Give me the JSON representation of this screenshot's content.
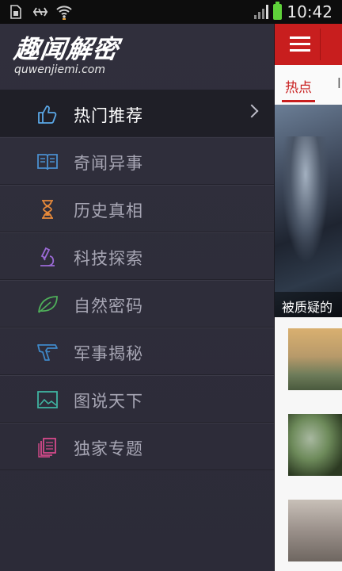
{
  "status_bar": {
    "time": "10:42",
    "icons": [
      "sim-icon",
      "usb-icon",
      "wifi-icon",
      "signal-icon",
      "battery-icon"
    ]
  },
  "drawer": {
    "brand_title": "趣闻解密",
    "brand_subtitle": "quwenjiemi.com",
    "items": [
      {
        "label": "热门推荐",
        "icon": "thumbs-up-icon",
        "color": "#5aa7e6",
        "active": true
      },
      {
        "label": "奇闻异事",
        "icon": "open-book-icon",
        "color": "#4a8fd0",
        "active": false
      },
      {
        "label": "历史真相",
        "icon": "hourglass-icon",
        "color": "#e88a3a",
        "active": false
      },
      {
        "label": "科技探索",
        "icon": "microscope-icon",
        "color": "#9b6ad6",
        "active": false
      },
      {
        "label": "自然密码",
        "icon": "leaf-icon",
        "color": "#4fb05a",
        "active": false
      },
      {
        "label": "军事揭秘",
        "icon": "gun-icon",
        "color": "#3f88c8",
        "active": false
      },
      {
        "label": "图说天下",
        "icon": "picture-icon",
        "color": "#3fb3a0",
        "active": false
      },
      {
        "label": "独家专题",
        "icon": "documents-icon",
        "color": "#d54a8a",
        "active": false
      }
    ]
  },
  "content": {
    "tab_active": "热点",
    "tab_next": "l",
    "hero_caption": "被质疑的"
  },
  "colors": {
    "brand_red": "#c81e1e",
    "drawer_bg": "#302f3c",
    "active_bg": "#1f1f27"
  }
}
